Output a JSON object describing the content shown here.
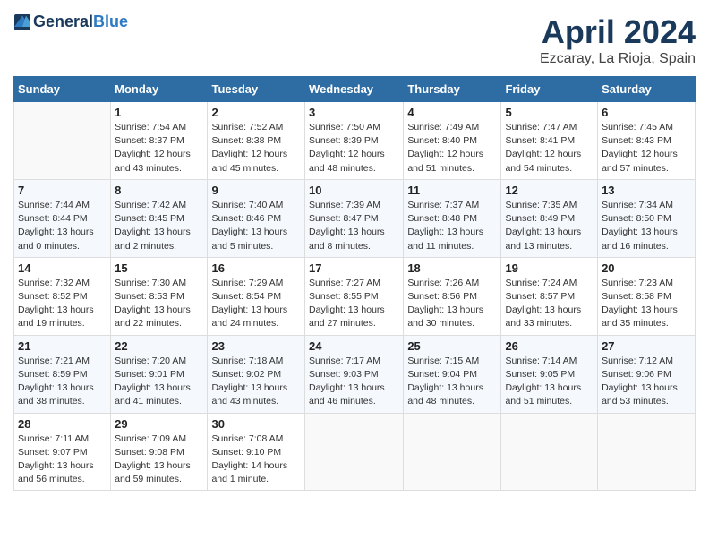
{
  "header": {
    "logo_line1": "General",
    "logo_line2": "Blue",
    "title": "April 2024",
    "location": "Ezcaray, La Rioja, Spain"
  },
  "columns": [
    "Sunday",
    "Monday",
    "Tuesday",
    "Wednesday",
    "Thursday",
    "Friday",
    "Saturday"
  ],
  "weeks": [
    [
      {
        "day": "",
        "info": ""
      },
      {
        "day": "1",
        "info": "Sunrise: 7:54 AM\nSunset: 8:37 PM\nDaylight: 12 hours\nand 43 minutes."
      },
      {
        "day": "2",
        "info": "Sunrise: 7:52 AM\nSunset: 8:38 PM\nDaylight: 12 hours\nand 45 minutes."
      },
      {
        "day": "3",
        "info": "Sunrise: 7:50 AM\nSunset: 8:39 PM\nDaylight: 12 hours\nand 48 minutes."
      },
      {
        "day": "4",
        "info": "Sunrise: 7:49 AM\nSunset: 8:40 PM\nDaylight: 12 hours\nand 51 minutes."
      },
      {
        "day": "5",
        "info": "Sunrise: 7:47 AM\nSunset: 8:41 PM\nDaylight: 12 hours\nand 54 minutes."
      },
      {
        "day": "6",
        "info": "Sunrise: 7:45 AM\nSunset: 8:43 PM\nDaylight: 12 hours\nand 57 minutes."
      }
    ],
    [
      {
        "day": "7",
        "info": "Sunrise: 7:44 AM\nSunset: 8:44 PM\nDaylight: 13 hours\nand 0 minutes."
      },
      {
        "day": "8",
        "info": "Sunrise: 7:42 AM\nSunset: 8:45 PM\nDaylight: 13 hours\nand 2 minutes."
      },
      {
        "day": "9",
        "info": "Sunrise: 7:40 AM\nSunset: 8:46 PM\nDaylight: 13 hours\nand 5 minutes."
      },
      {
        "day": "10",
        "info": "Sunrise: 7:39 AM\nSunset: 8:47 PM\nDaylight: 13 hours\nand 8 minutes."
      },
      {
        "day": "11",
        "info": "Sunrise: 7:37 AM\nSunset: 8:48 PM\nDaylight: 13 hours\nand 11 minutes."
      },
      {
        "day": "12",
        "info": "Sunrise: 7:35 AM\nSunset: 8:49 PM\nDaylight: 13 hours\nand 13 minutes."
      },
      {
        "day": "13",
        "info": "Sunrise: 7:34 AM\nSunset: 8:50 PM\nDaylight: 13 hours\nand 16 minutes."
      }
    ],
    [
      {
        "day": "14",
        "info": "Sunrise: 7:32 AM\nSunset: 8:52 PM\nDaylight: 13 hours\nand 19 minutes."
      },
      {
        "day": "15",
        "info": "Sunrise: 7:30 AM\nSunset: 8:53 PM\nDaylight: 13 hours\nand 22 minutes."
      },
      {
        "day": "16",
        "info": "Sunrise: 7:29 AM\nSunset: 8:54 PM\nDaylight: 13 hours\nand 24 minutes."
      },
      {
        "day": "17",
        "info": "Sunrise: 7:27 AM\nSunset: 8:55 PM\nDaylight: 13 hours\nand 27 minutes."
      },
      {
        "day": "18",
        "info": "Sunrise: 7:26 AM\nSunset: 8:56 PM\nDaylight: 13 hours\nand 30 minutes."
      },
      {
        "day": "19",
        "info": "Sunrise: 7:24 AM\nSunset: 8:57 PM\nDaylight: 13 hours\nand 33 minutes."
      },
      {
        "day": "20",
        "info": "Sunrise: 7:23 AM\nSunset: 8:58 PM\nDaylight: 13 hours\nand 35 minutes."
      }
    ],
    [
      {
        "day": "21",
        "info": "Sunrise: 7:21 AM\nSunset: 8:59 PM\nDaylight: 13 hours\nand 38 minutes."
      },
      {
        "day": "22",
        "info": "Sunrise: 7:20 AM\nSunset: 9:01 PM\nDaylight: 13 hours\nand 41 minutes."
      },
      {
        "day": "23",
        "info": "Sunrise: 7:18 AM\nSunset: 9:02 PM\nDaylight: 13 hours\nand 43 minutes."
      },
      {
        "day": "24",
        "info": "Sunrise: 7:17 AM\nSunset: 9:03 PM\nDaylight: 13 hours\nand 46 minutes."
      },
      {
        "day": "25",
        "info": "Sunrise: 7:15 AM\nSunset: 9:04 PM\nDaylight: 13 hours\nand 48 minutes."
      },
      {
        "day": "26",
        "info": "Sunrise: 7:14 AM\nSunset: 9:05 PM\nDaylight: 13 hours\nand 51 minutes."
      },
      {
        "day": "27",
        "info": "Sunrise: 7:12 AM\nSunset: 9:06 PM\nDaylight: 13 hours\nand 53 minutes."
      }
    ],
    [
      {
        "day": "28",
        "info": "Sunrise: 7:11 AM\nSunset: 9:07 PM\nDaylight: 13 hours\nand 56 minutes."
      },
      {
        "day": "29",
        "info": "Sunrise: 7:09 AM\nSunset: 9:08 PM\nDaylight: 13 hours\nand 59 minutes."
      },
      {
        "day": "30",
        "info": "Sunrise: 7:08 AM\nSunset: 9:10 PM\nDaylight: 14 hours\nand 1 minute."
      },
      {
        "day": "",
        "info": ""
      },
      {
        "day": "",
        "info": ""
      },
      {
        "day": "",
        "info": ""
      },
      {
        "day": "",
        "info": ""
      }
    ]
  ]
}
